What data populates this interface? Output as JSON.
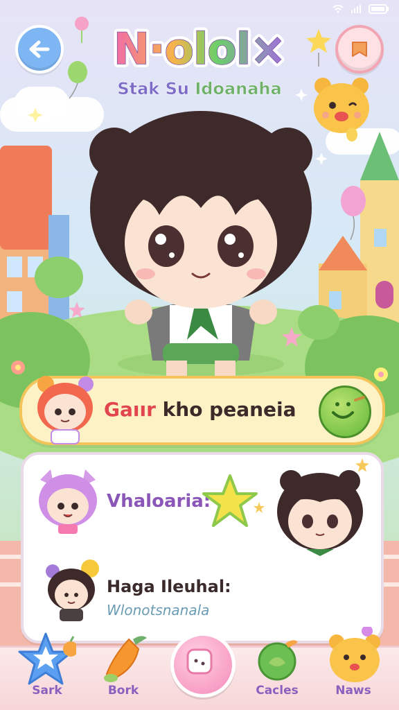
{
  "app": {
    "logo_text": "N·olol×",
    "subtitle_left": "Stak Su",
    "subtitle_right": "Idoanaha"
  },
  "header": {
    "back_icon": "back-arrow-icon",
    "menu_icon": "bookmark-icon"
  },
  "character_select": {
    "label_red": "Gaıır",
    "label_rest": " kho peaneia",
    "confirm_icon": "smile-confirm-icon"
  },
  "info_card": {
    "line1": "Vhaloaria:",
    "line2": "Haga Ileuhal:",
    "line3": "Wlonotsnanala"
  },
  "bottom_nav": {
    "items": [
      {
        "label": "Sark",
        "icon": "star-icon"
      },
      {
        "label": "Bork",
        "icon": "carrot-icon"
      },
      {
        "label": "",
        "icon": "camera-icon"
      },
      {
        "label": "Cacles",
        "icon": "leaf-icon"
      },
      {
        "label": "Naws",
        "icon": "bear-icon"
      }
    ]
  },
  "colors": {
    "accent_purple": "#8a56b8",
    "accent_yellow": "#f2c45a",
    "accent_green": "#62b93a",
    "accent_pink": "#f58ab8"
  }
}
